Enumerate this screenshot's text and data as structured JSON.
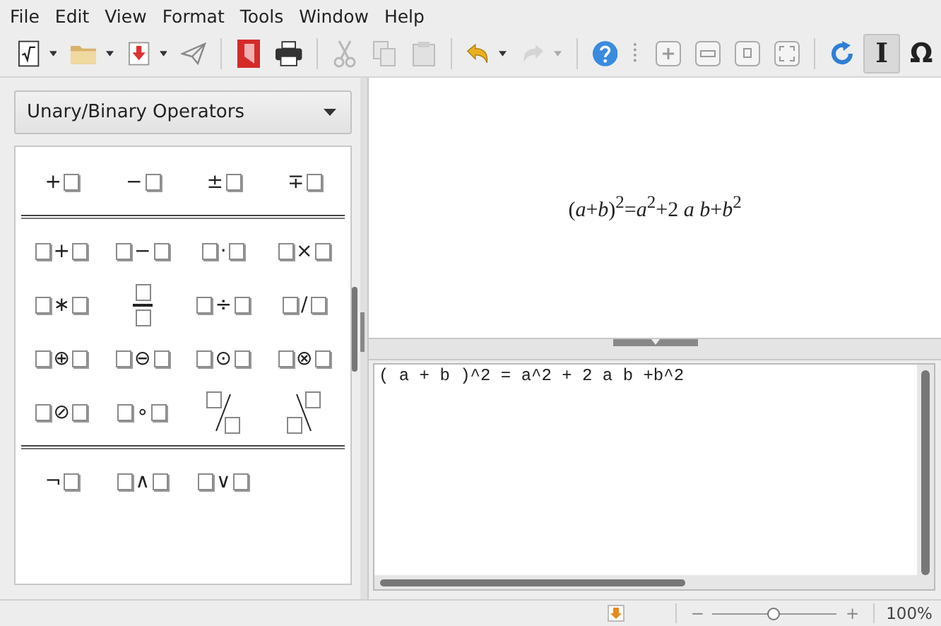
{
  "menu": [
    "File",
    "Edit",
    "View",
    "Format",
    "Tools",
    "Window",
    "Help"
  ],
  "toolbar": [
    {
      "items": [
        {
          "kind": "new-formula",
          "dropdown": true,
          "disabled": false,
          "selected": false
        },
        {
          "kind": "open",
          "dropdown": true,
          "disabled": false,
          "selected": false
        },
        {
          "kind": "save",
          "dropdown": true,
          "disabled": false,
          "selected": false
        },
        {
          "kind": "send",
          "dropdown": false,
          "disabled": false,
          "selected": false
        }
      ]
    },
    {
      "items": [
        {
          "kind": "pdf",
          "dropdown": false,
          "disabled": false,
          "selected": false
        },
        {
          "kind": "print",
          "dropdown": false,
          "disabled": false,
          "selected": false
        }
      ]
    },
    {
      "items": [
        {
          "kind": "cut",
          "dropdown": false,
          "disabled": true,
          "selected": false
        },
        {
          "kind": "copy",
          "dropdown": false,
          "disabled": true,
          "selected": false
        },
        {
          "kind": "paste",
          "dropdown": false,
          "disabled": true,
          "selected": false
        }
      ]
    },
    {
      "items": [
        {
          "kind": "undo",
          "dropdown": true,
          "disabled": false,
          "selected": false
        },
        {
          "kind": "redo",
          "dropdown": true,
          "disabled": true,
          "selected": false
        }
      ]
    },
    {
      "items": [
        {
          "kind": "help",
          "dropdown": false,
          "disabled": false,
          "selected": false
        }
      ]
    },
    {
      "items": [
        {
          "kind": "zoom-in",
          "dropdown": false,
          "disabled": false,
          "selected": false
        },
        {
          "kind": "zoom-out",
          "dropdown": false,
          "disabled": false,
          "selected": false
        },
        {
          "kind": "zoom-100",
          "dropdown": false,
          "disabled": false,
          "selected": false
        },
        {
          "kind": "show-all",
          "dropdown": false,
          "disabled": false,
          "selected": false
        }
      ]
    },
    {
      "items": [
        {
          "kind": "update",
          "dropdown": false,
          "disabled": false,
          "selected": false
        },
        {
          "kind": "cursor",
          "glyph": "I",
          "dropdown": false,
          "disabled": false,
          "selected": true
        },
        {
          "kind": "symbols",
          "glyph": "Ω",
          "dropdown": false,
          "disabled": false,
          "selected": false
        }
      ]
    }
  ],
  "elements": {
    "category": "Unary/Binary Operators",
    "groups": [
      {
        "items": [
          {
            "kind": "unary",
            "op": "+"
          },
          {
            "kind": "unary",
            "op": "−"
          },
          {
            "kind": "unary",
            "op": "±"
          },
          {
            "kind": "unary",
            "op": "∓"
          }
        ]
      },
      {
        "items": [
          {
            "kind": "binary",
            "op": "+"
          },
          {
            "kind": "binary",
            "op": "−"
          },
          {
            "kind": "binary",
            "op": "·"
          },
          {
            "kind": "binary",
            "op": "×"
          },
          {
            "kind": "binary",
            "op": "∗"
          },
          {
            "kind": "fraction"
          },
          {
            "kind": "binary",
            "op": "÷"
          },
          {
            "kind": "binary",
            "op": "/"
          },
          {
            "kind": "binary",
            "op": "⊕"
          },
          {
            "kind": "binary",
            "op": "⊖"
          },
          {
            "kind": "binary",
            "op": "⊙"
          },
          {
            "kind": "binary",
            "op": "⊗"
          },
          {
            "kind": "binary",
            "op": "⊘"
          },
          {
            "kind": "binary",
            "op": "∘"
          },
          {
            "kind": "wideslash"
          },
          {
            "kind": "widebslash"
          }
        ]
      },
      {
        "items": [
          {
            "kind": "unary",
            "op": "¬"
          },
          {
            "kind": "binary",
            "op": "∧"
          },
          {
            "kind": "binary",
            "op": "∨"
          }
        ]
      }
    ]
  },
  "formula": "(*a*+*b*)$^{2}$=*a*$^{2}$+2 *a* *b*+*b*$^{2}$",
  "command": "( a + b )^2 = a^2 + 2 a b +b^2",
  "status": {
    "zoom": {
      "level": 0.5,
      "minus": "−",
      "plus": "+",
      "reading": "100%"
    }
  }
}
